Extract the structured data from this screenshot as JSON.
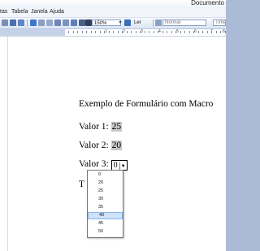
{
  "window": {
    "title": "Documento"
  },
  "menu": {
    "items": [
      "tas",
      "Tabela",
      "Janela",
      "Ajuda"
    ]
  },
  "toolbar": {
    "zoom": "150%",
    "read_label": "Ler",
    "style": "Normal",
    "font": "Times"
  },
  "ruler": {
    "numbers": [
      "1",
      "2",
      "3",
      "4",
      "5",
      "6",
      "7",
      "8"
    ]
  },
  "document": {
    "heading": "Exemplo de Formulário com Macro",
    "valor1_label": "Valor 1:",
    "valor1_value": "25",
    "valor2_label": "Valor 2:",
    "valor2_value": "20",
    "valor3_label": "Valor 3:",
    "valor3_value": "0",
    "partial_text": "T"
  },
  "dropdown": {
    "options": [
      "0",
      "20",
      "25",
      "30",
      "35",
      "40",
      "45",
      "50"
    ],
    "selected": "40"
  },
  "colors": {
    "page": "#ffffff",
    "workspace": "#abbad6",
    "field_shading": "#c7c7c7",
    "dropdown_highlight": "#cfe2fa"
  }
}
